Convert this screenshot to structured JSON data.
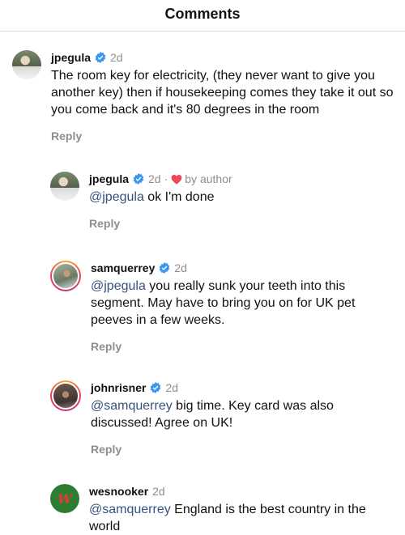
{
  "header": {
    "title": "Comments"
  },
  "colors": {
    "verified": "#3897f0",
    "heart": "#ed4956",
    "mention": "#37517e",
    "muted": "#8e8e8e"
  },
  "comments": [
    {
      "username": "jpegula",
      "verified": true,
      "time": "2d",
      "mention": "",
      "text": "The room key for electricity, (they never want to give you another key) then if housekeeping comes they take it out so you come back and it's 80 degrees in the room",
      "reply": "Reply"
    },
    {
      "username": "jpegula",
      "verified": true,
      "time": "2d",
      "liked_by_author": "by author",
      "mention": "@jpegula",
      "text": " ok I'm done",
      "reply": "Reply"
    },
    {
      "username": "samquerrey",
      "verified": true,
      "time": "2d",
      "mention": "@jpegula",
      "text": " you really sunk your teeth into this segment. May have to bring you on for UK pet peeves in a few weeks.",
      "reply": "Reply"
    },
    {
      "username": "johnrisner",
      "verified": true,
      "time": "2d",
      "mention": "@samquerrey",
      "text": " big time. Key card was also discussed! Agree on UK!",
      "reply": "Reply"
    },
    {
      "username": "wesnooker",
      "verified": false,
      "time": "2d",
      "mention": "@samquerrey",
      "text": " England is the best country in the world",
      "avatar_logo": "W"
    }
  ]
}
